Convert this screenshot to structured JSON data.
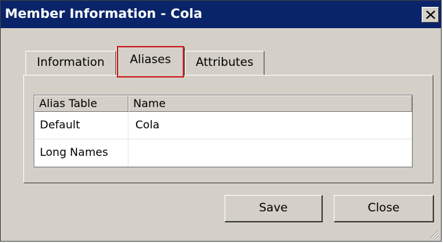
{
  "window": {
    "title": "Member Information - Cola"
  },
  "tabs": [
    {
      "label": "Information"
    },
    {
      "label": "Aliases"
    },
    {
      "label": "Attributes"
    }
  ],
  "grid": {
    "columns": [
      "Alias Table",
      "Name"
    ],
    "rows": [
      {
        "alias_table": "Default",
        "name": "Cola"
      },
      {
        "alias_table": "Long Names",
        "name": ""
      }
    ]
  },
  "buttons": {
    "save": "Save",
    "close": "Close"
  },
  "colors": {
    "titlebar": "#0a246a",
    "face": "#d4d0c8",
    "highlight": "#cc2020"
  }
}
